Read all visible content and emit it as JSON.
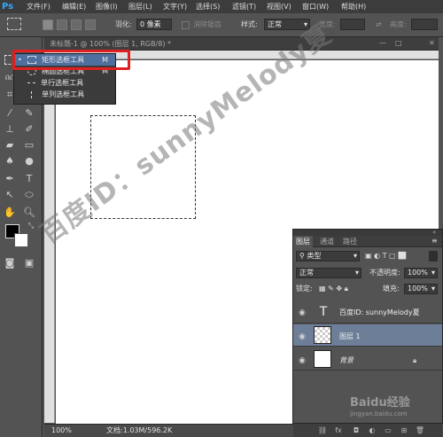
{
  "app": {
    "logo": "Ps"
  },
  "menu": [
    "文件(F)",
    "编辑(E)",
    "图像(I)",
    "图层(L)",
    "文字(Y)",
    "选择(S)",
    "滤镜(T)",
    "视图(V)",
    "窗口(W)",
    "帮助(H)"
  ],
  "options_bar": {
    "feather_label": "羽化:",
    "feather_value": "0 像素",
    "antialias_label": "消除锯齿",
    "style_label": "样式:",
    "style_value": "正常",
    "width_label": "宽度:",
    "height_label": "高度:"
  },
  "document": {
    "title": "未标题-1 @ 100% (图层 1, RGB/8) *"
  },
  "flyout": {
    "items": [
      {
        "label": "矩形选框工具",
        "shortcut": "M",
        "active": true
      },
      {
        "label": "椭圆选框工具",
        "shortcut": "M",
        "active": false
      },
      {
        "label": "单行选框工具",
        "shortcut": "",
        "active": false
      },
      {
        "label": "单列选框工具",
        "shortcut": "",
        "active": false
      }
    ]
  },
  "status": {
    "zoom": "100%",
    "doc_info": "文档:1.03M/596.2K"
  },
  "layers_panel": {
    "tabs": [
      "图层",
      "通道",
      "路径"
    ],
    "filter_label": "类型",
    "blend_mode": "正常",
    "opacity_label": "不透明度:",
    "opacity_value": "100%",
    "lock_label": "锁定:",
    "fill_label": "填充:",
    "fill_value": "100%",
    "layers": [
      {
        "name": "百度ID: sunnyMelody夏",
        "kind": "text",
        "selected": false
      },
      {
        "name": "图层 1",
        "kind": "pixel",
        "selected": true
      },
      {
        "name": "背景",
        "kind": "background",
        "selected": false
      }
    ]
  },
  "watermark": {
    "text": "百度ID：sunnyMelody夏",
    "logo_text": "Baidu经验",
    "url": "jingyan.baidu.com"
  },
  "colors": {
    "highlight": "#e02020",
    "selected_layer": "#6d7f98",
    "ps_blue": "#31a8ff"
  }
}
